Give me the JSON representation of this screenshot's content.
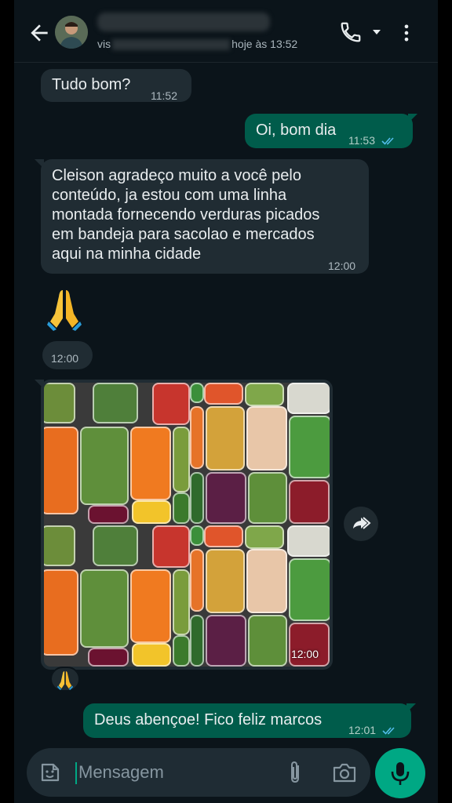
{
  "header": {
    "contact_name": "",
    "status_prefix": "vis",
    "status_suffix": "hoje às 13:52",
    "icons": [
      "back-arrow-icon",
      "avatar",
      "phone-icon",
      "caret-down-icon",
      "more-vert-icon"
    ]
  },
  "messages": [
    {
      "direction": "in",
      "text": "Tudo bom?",
      "time": "11:52"
    },
    {
      "direction": "out",
      "text": "Oi, bom dia",
      "time": "11:53",
      "read": true
    },
    {
      "direction": "in",
      "lines": [
        "Cleison agradeço muito a você pelo",
        "conteúdo, ja estou com uma linha",
        "montada fornecendo verduras picados",
        "em bandeja para sacolao e mercados",
        "aqui na minha cidade"
      ],
      "time": "12:00"
    },
    {
      "direction": "in",
      "emoji": "🙏",
      "time": "12:00"
    },
    {
      "direction": "in",
      "type": "image",
      "time": "12:00",
      "reaction": "🙏"
    },
    {
      "direction": "out",
      "text": "Deus abençoe! Fico feliz marcos",
      "time": "12:01",
      "read": true
    }
  ],
  "composer": {
    "placeholder": "Mensagem",
    "icons": [
      "sticker-icon",
      "paperclip-icon",
      "camera-icon",
      "microphone-icon"
    ]
  },
  "colors": {
    "background": "#0b141a",
    "incoming": "#202c33",
    "outgoing": "#005c4b",
    "accent": "#00a884",
    "read_ticks": "#53bdeb"
  }
}
